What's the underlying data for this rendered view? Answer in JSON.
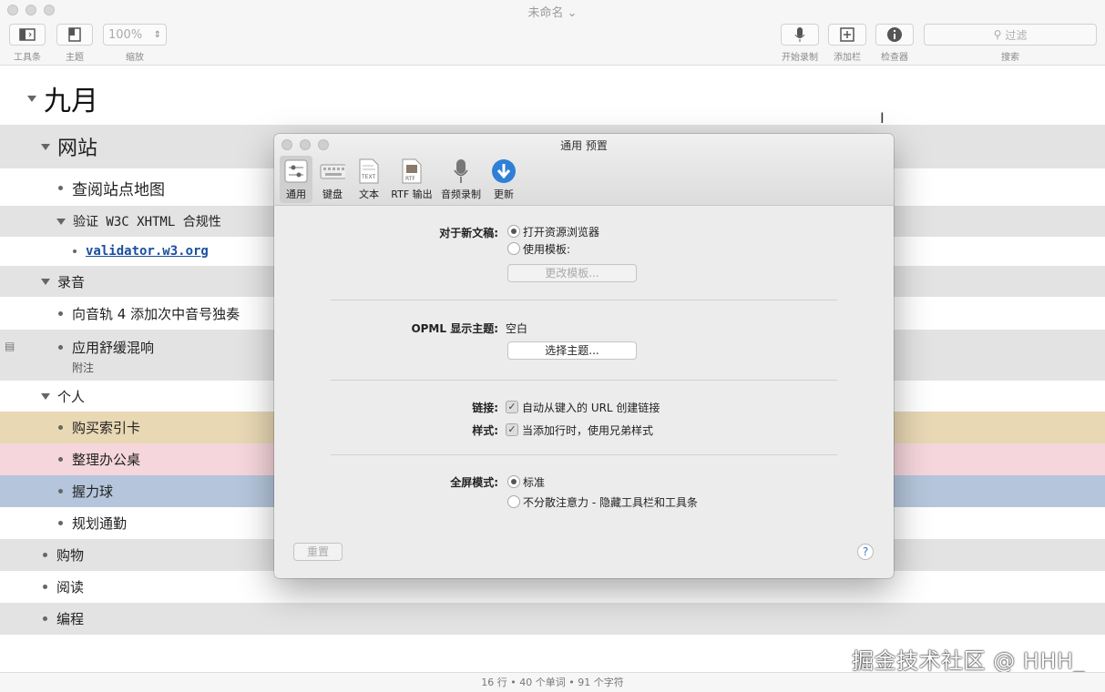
{
  "window": {
    "title": "未命名 ⌄"
  },
  "toolbar": {
    "sidebar_label": "工具条",
    "theme_label": "主题",
    "zoom_value": "100%",
    "zoom_label": "缩放",
    "record_label": "开始录制",
    "add_column_label": "添加栏",
    "inspector_label": "检查器",
    "search_placeholder": "过滤",
    "search_label": "搜索"
  },
  "outline": {
    "rows": [
      {
        "text": "九月",
        "level": 0,
        "marker": "triangle",
        "bg": "white"
      },
      {
        "text": "网站",
        "level": 1,
        "marker": "triangle",
        "bg": "grey"
      },
      {
        "text": "查阅站点地图",
        "level": 2,
        "marker": "dot",
        "bg": "white"
      },
      {
        "text": "验证 W3C XHTML 合规性",
        "level": 2,
        "marker": "triangle",
        "bg": "grey"
      },
      {
        "text": "validator.w3.org",
        "level": 3,
        "marker": "dot",
        "bg": "white",
        "link": true
      },
      {
        "text": "录音",
        "level": 1,
        "marker": "triangle",
        "bg": "grey"
      },
      {
        "text": "向音轨 4 添加次中音号独奏",
        "level": 2,
        "marker": "dot",
        "bg": "white"
      },
      {
        "text": "应用舒缓混响",
        "note": "附注",
        "level": 2,
        "marker": "dot",
        "bg": "grey"
      },
      {
        "text": "个人",
        "level": 1,
        "marker": "triangle",
        "bg": "white"
      },
      {
        "text": "购买索引卡",
        "level": 2,
        "marker": "dot",
        "bg": "tan"
      },
      {
        "text": "整理办公桌",
        "level": 2,
        "marker": "dot",
        "bg": "pink"
      },
      {
        "text": "握力球",
        "level": 2,
        "marker": "dot",
        "bg": "blue"
      },
      {
        "text": "规划通勤",
        "level": 2,
        "marker": "dot",
        "bg": "white"
      },
      {
        "text": "购物",
        "level": 1,
        "marker": "dot",
        "bg": "grey"
      },
      {
        "text": "阅读",
        "level": 1,
        "marker": "dot",
        "bg": "white"
      },
      {
        "text": "编程",
        "level": 1,
        "marker": "dot",
        "bg": "grey"
      }
    ]
  },
  "status": {
    "text": "16 行 • 40 个单词 • 91 个字符"
  },
  "watermark": "掘金技术社区 @ HHH_",
  "prefs": {
    "title": "通用 预置",
    "tabs": [
      "通用",
      "键盘",
      "文本",
      "RTF 输出",
      "音频录制",
      "更新"
    ],
    "new_doc_label": "对于新文稿:",
    "open_browser": "打开资源浏览器",
    "use_template": "使用模板:",
    "change_template": "更改模板...",
    "opml_label": "OPML 显示主题:",
    "opml_value": "空白",
    "choose_theme": "选择主题...",
    "links_label": "链接:",
    "links_option": "自动从键入的 URL 创建链接",
    "style_label": "样式:",
    "style_option": "当添加行时，使用兄弟样式",
    "fullscreen_label": "全屏模式:",
    "fullscreen_standard": "标准",
    "fullscreen_distraction": "不分散注意力 - 隐藏工具栏和工具条",
    "reset": "重置",
    "help": "?"
  },
  "colors": {
    "grey": "#e3e3e3",
    "tan": "#e8d8b4",
    "pink": "#f5d6dc",
    "blue": "#b5c6dc",
    "link": "#1a4fa0"
  }
}
